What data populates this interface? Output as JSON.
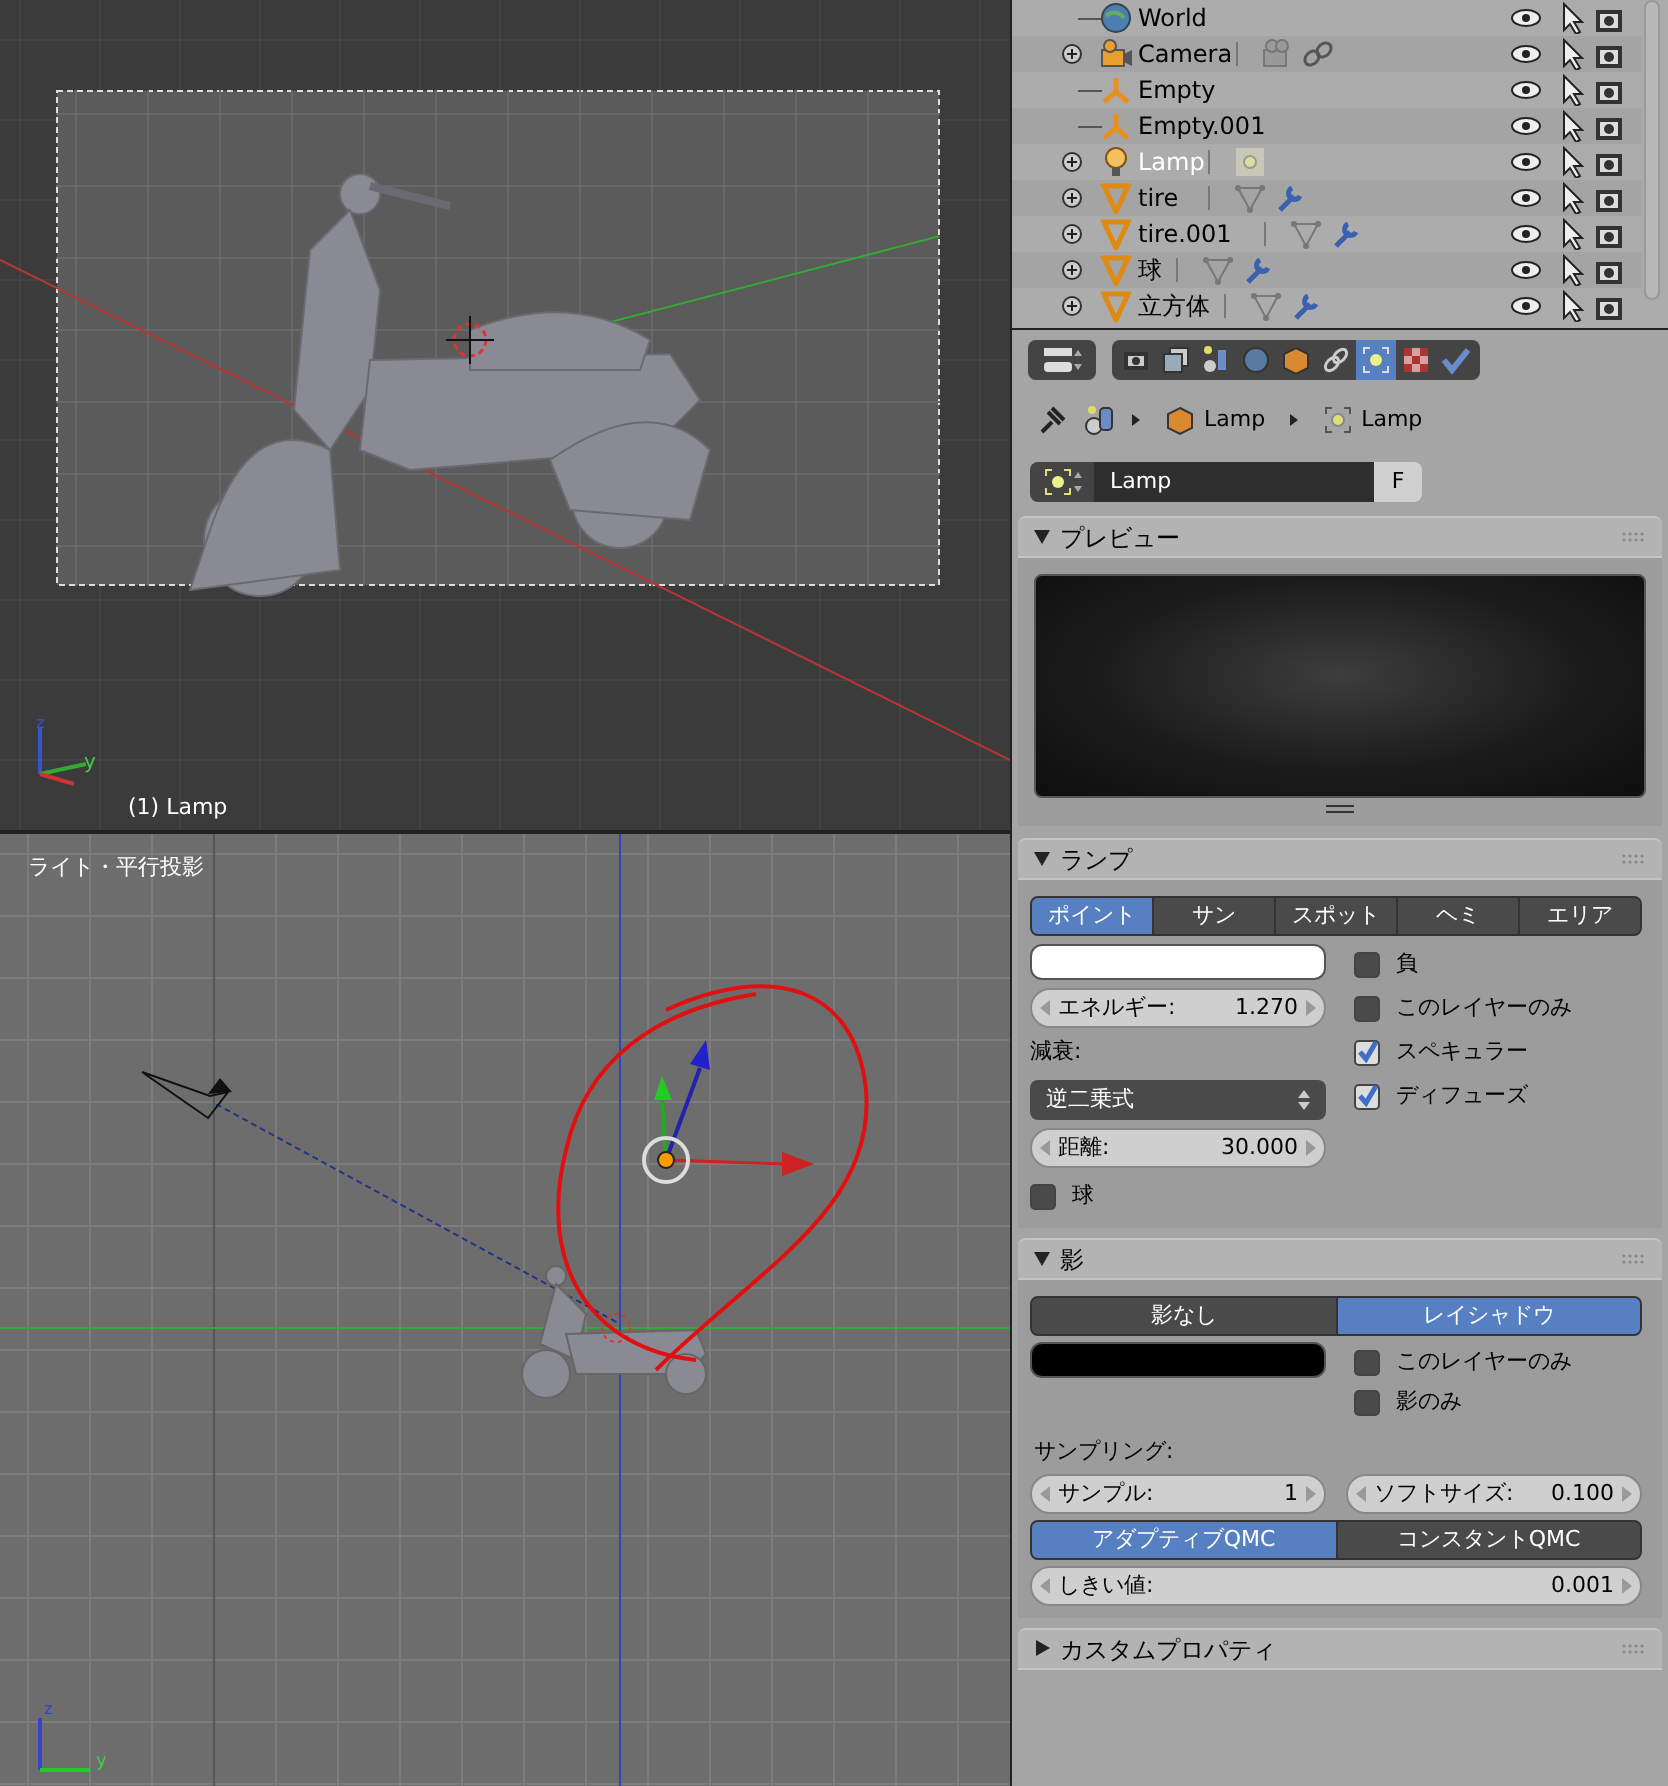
{
  "viewport_top": {
    "object_label": "(1) Lamp",
    "axis_labels": [
      "z",
      "y"
    ]
  },
  "viewport_bottom": {
    "view_label": "ライト・平行投影",
    "axis_labels": [
      "z",
      "y"
    ]
  },
  "outliner": {
    "rows": [
      {
        "label": "World",
        "kind": "world",
        "expandable": false,
        "selected": false
      },
      {
        "label": "Camera",
        "kind": "camera",
        "expandable": true,
        "selected": false
      },
      {
        "label": "Empty",
        "kind": "empty",
        "expandable": false,
        "selected": false
      },
      {
        "label": "Empty.001",
        "kind": "empty",
        "expandable": false,
        "selected": false
      },
      {
        "label": "Lamp",
        "kind": "lamp",
        "expandable": true,
        "selected": true
      },
      {
        "label": "tire",
        "kind": "mesh",
        "expandable": true,
        "selected": false
      },
      {
        "label": "tire.001",
        "kind": "mesh",
        "expandable": true,
        "selected": false
      },
      {
        "label": "球",
        "kind": "mesh",
        "expandable": true,
        "selected": false
      },
      {
        "label": "立方体",
        "kind": "mesh",
        "expandable": true,
        "selected": false
      }
    ]
  },
  "properties": {
    "tabs": [
      {
        "kind": "render",
        "selected": false
      },
      {
        "kind": "layers",
        "selected": false
      },
      {
        "kind": "scene",
        "selected": false
      },
      {
        "kind": "world",
        "selected": false
      },
      {
        "kind": "object",
        "selected": false
      },
      {
        "kind": "constraints",
        "selected": false
      },
      {
        "kind": "lamp",
        "selected": true
      },
      {
        "kind": "texture",
        "selected": false
      },
      {
        "kind": "physics",
        "selected": false
      }
    ],
    "breadcrumb": [
      "Lamp",
      "Lamp"
    ],
    "datablock": {
      "value": "Lamp",
      "fake_user": "F"
    },
    "preview": {
      "title": "プレビュー",
      "expanded": true
    },
    "lamp": {
      "title": "ランプ",
      "expanded": true,
      "types": [
        {
          "label": "ポイント",
          "selected": true
        },
        {
          "label": "サン",
          "selected": false
        },
        {
          "label": "スポット",
          "selected": false
        },
        {
          "label": "ヘミ",
          "selected": false
        },
        {
          "label": "エリア",
          "selected": false
        }
      ],
      "color": "#ffffff",
      "energy": {
        "label": "エネルギー:",
        "value": "1.270"
      },
      "falloff_label": "減衰:",
      "falloff": "逆二乗式",
      "distance": {
        "label": "距離:",
        "value": "30.000"
      },
      "sphere": {
        "label": "球",
        "checked": false
      },
      "options": [
        {
          "label": "負",
          "checked": false
        },
        {
          "label": "このレイヤーのみ",
          "checked": false
        },
        {
          "label": "スペキュラー",
          "checked": true
        },
        {
          "label": "ディフューズ",
          "checked": true
        }
      ]
    },
    "shadow": {
      "title": "影",
      "expanded": true,
      "modes": [
        {
          "label": "影なし",
          "selected": false
        },
        {
          "label": "レイシャドウ",
          "selected": true
        }
      ],
      "color": "#000000",
      "options": [
        {
          "label": "このレイヤーのみ",
          "checked": false
        },
        {
          "label": "影のみ",
          "checked": false
        }
      ],
      "sampling_label": "サンプリング:",
      "samples": {
        "label": "サンプル:",
        "value": "1"
      },
      "soft_size": {
        "label": "ソフトサイズ:",
        "value": "0.100"
      },
      "qmc": [
        {
          "label": "アダプティブQMC",
          "selected": true
        },
        {
          "label": "コンスタントQMC",
          "selected": false
        }
      ],
      "threshold": {
        "label": "しきい値:",
        "value": "0.001"
      }
    },
    "custom_props": {
      "title": "カスタムプロパティ",
      "expanded": false
    }
  }
}
